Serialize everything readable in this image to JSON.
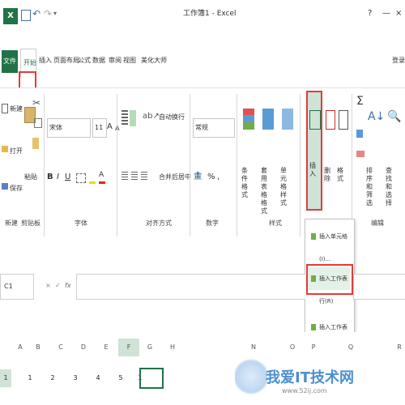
{
  "window": {
    "title": "工作簿1 - Excel",
    "help": "?",
    "minimize": "—",
    "close": "×"
  },
  "tabs": {
    "file": "文件",
    "home": "开始",
    "insert": "插入",
    "page_layout": "页面布局",
    "formulas": "公式",
    "data": "数据",
    "review": "审阅",
    "view": "视图",
    "beautify": "美化大师",
    "login": "登录"
  },
  "ribbon": {
    "clipboard": {
      "new": "新建",
      "open": "打开",
      "save": "保存",
      "paste": "粘贴"
    },
    "font": {
      "name": "宋体",
      "size": "11",
      "bold": "B",
      "italic": "I",
      "underline": "U",
      "grow": "A",
      "shrink": "A"
    },
    "alignment": {
      "wrap": "自动换行",
      "merge": "合并后居中"
    },
    "number": {
      "format": "常规",
      "percent": "%",
      "comma": ","
    },
    "styles": {
      "cond_format": "条件格式",
      "table_format": "套用表格格式",
      "cell_styles": "单元格样式"
    },
    "cells": {
      "insert": "插入",
      "delete": "删除",
      "format": "格式"
    },
    "editing": {
      "sort_filter": "排序和筛选",
      "find_select": "查找和选择",
      "sum": "Σ"
    },
    "groups": {
      "new_open": "新建",
      "clipboard": "剪贴板",
      "font": "字体",
      "alignment": "对齐方式",
      "number": "数字",
      "style": "样式",
      "editing": "编辑"
    }
  },
  "insert_menu": [
    {
      "label": "插入单元格(I)..."
    },
    {
      "label": "插入工作表行(R)"
    },
    {
      "label": "插入工作表列(C)"
    }
  ],
  "formula_bar": {
    "name_box": "C1",
    "cancel": "×",
    "enter": "✓",
    "fx": "fx"
  },
  "sheet": {
    "columns": [
      "A",
      "B",
      "C",
      "D",
      "E",
      "F",
      "G",
      "H",
      "N",
      "O",
      "P",
      "Q",
      "R"
    ],
    "row_number": "1",
    "row1": [
      "1",
      "2",
      "3",
      "4",
      "5",
      "1",
      ""
    ]
  },
  "watermark": {
    "text": "我爱IT技术网",
    "url": "www.52ij.com"
  },
  "colors": {
    "accent": "#217346",
    "highlight_red": "#e23b3b",
    "selected": "#cfe3d6"
  }
}
